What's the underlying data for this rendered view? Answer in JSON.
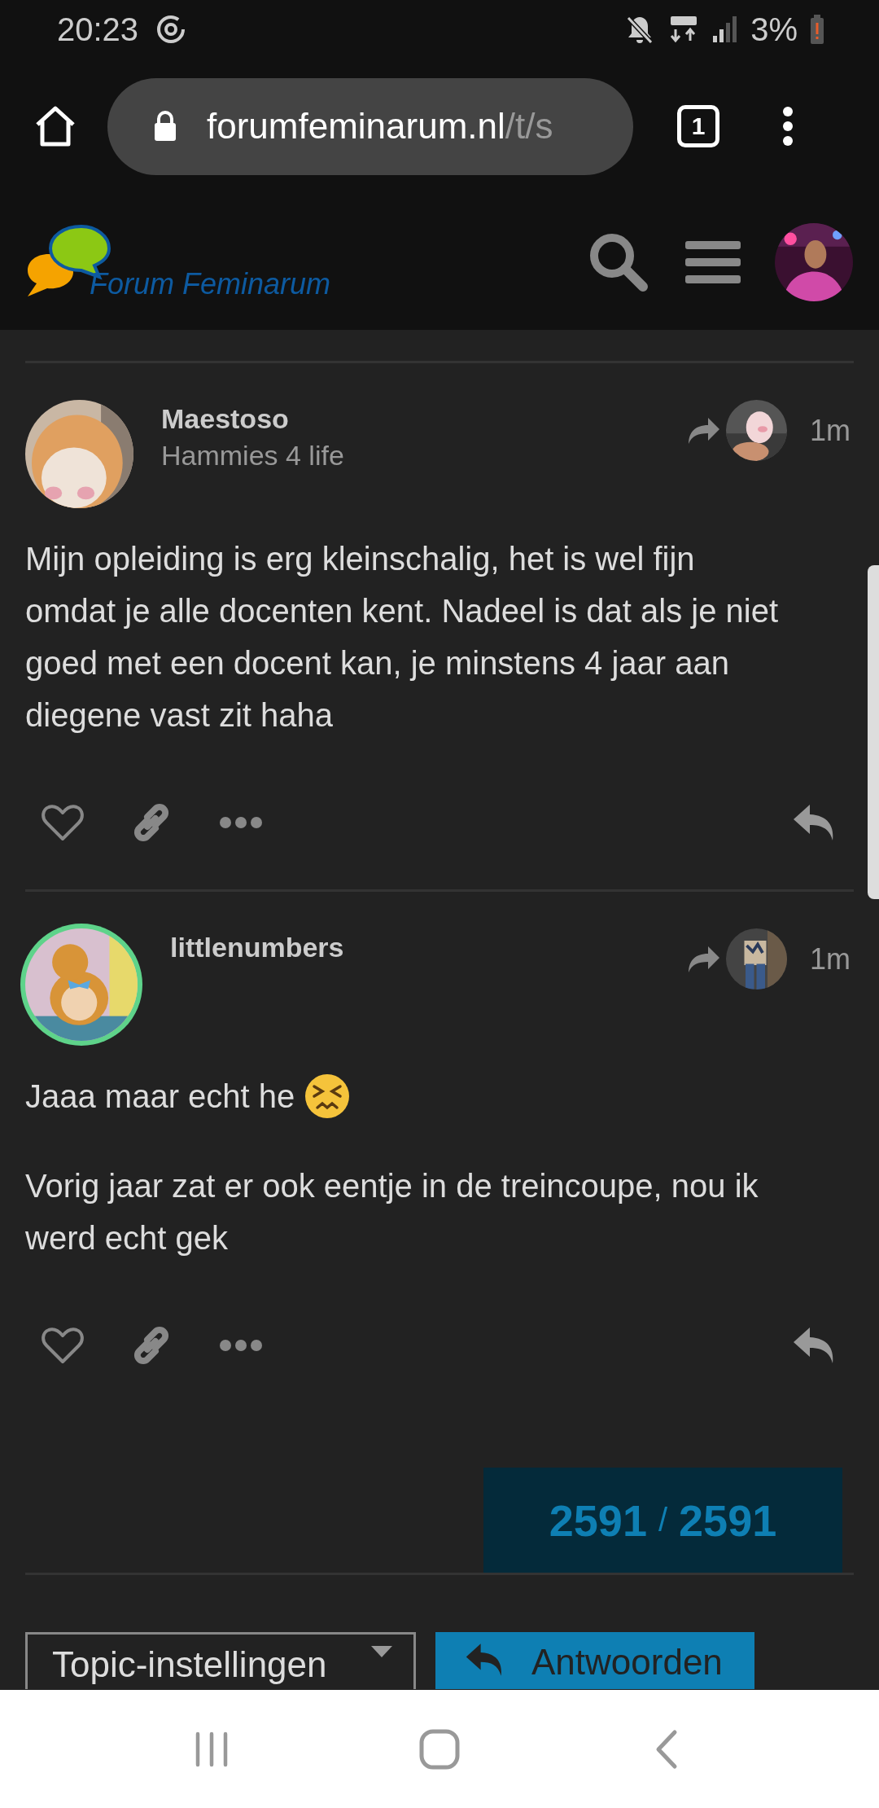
{
  "status_bar": {
    "time": "20:23",
    "battery": "3%"
  },
  "browser": {
    "domain": "forumfeminarum.nl",
    "path": "/t/s",
    "tab_count": "1"
  },
  "header": {
    "logo_text": "Forum Feminarum"
  },
  "posts": [
    {
      "username": "Maestoso",
      "user_title": "Hammies 4 life",
      "avatar_ringed": false,
      "time": "1m",
      "liked": false,
      "paragraphs": [
        {
          "text": "Mijn opleiding is erg kleinschalig, het is wel fijn omdat je alle docenten kent. Nadeel is dat als je niet goed met een docent kan, je minstens 4 jaar aan diegene vast zit haha"
        }
      ]
    },
    {
      "username": "littlenumbers",
      "avatar_ringed": true,
      "time": "1m",
      "liked": false,
      "paragraphs": [
        {
          "text": "Jaaa maar echt he",
          "trailing_emoji": true
        },
        {
          "text": "Vorig jaar zat er ook eentje in de treincoupe, nou ik werd echt gek"
        }
      ]
    }
  ],
  "progress": {
    "current": "2591",
    "separator": "/",
    "total": "2591"
  },
  "footer_buttons": [
    {
      "label": "Topic-instellingen",
      "kind": "dropdown"
    },
    {
      "label": "Antwoorden",
      "kind": "reply"
    }
  ]
}
